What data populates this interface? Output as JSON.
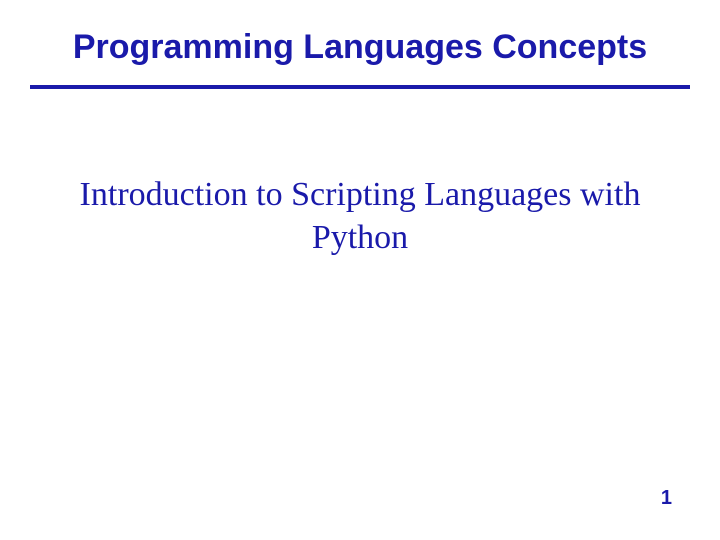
{
  "slide": {
    "title": "Programming Languages Concepts",
    "subtitle": "Introduction to Scripting Languages with Python",
    "page_number": "1"
  }
}
